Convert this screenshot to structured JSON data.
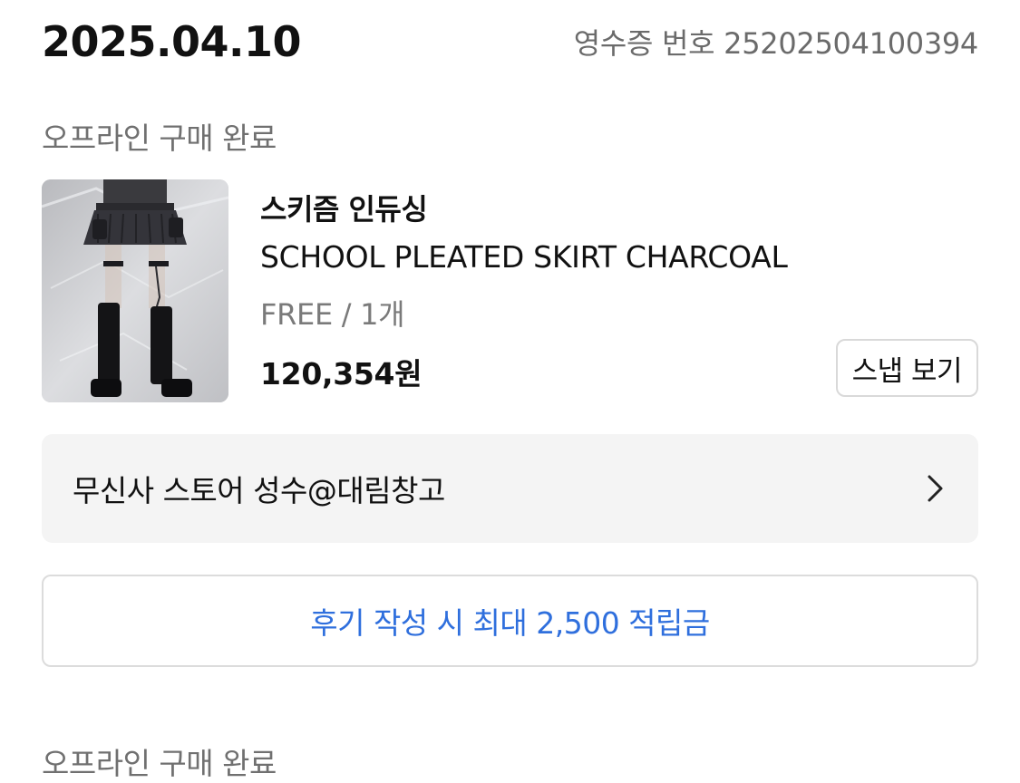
{
  "header": {
    "date": "2025.04.10",
    "receipt_label": "영수증 번호 25202504100394"
  },
  "orders": [
    {
      "status": "오프라인 구매 완료",
      "product": {
        "brand": "스키즘 인듀싱",
        "name": "SCHOOL PLEATED SKIRT CHARCOAL",
        "option": "FREE / 1개",
        "price": "120,354원",
        "snap_label": "스냅 보기",
        "image_icon": "product-photo"
      },
      "store": {
        "name": "무신사 스토어 성수@대림창고",
        "icon": "chevron-right-icon"
      },
      "review_label": "후기 작성 시 최대 2,500 적립금"
    },
    {
      "status": "오프라인 구매 완료"
    }
  ],
  "colors": {
    "accent_blue": "#2f6fdd",
    "muted_text": "#707070",
    "store_bg": "#f4f4f4",
    "border": "#dcdcdc"
  }
}
